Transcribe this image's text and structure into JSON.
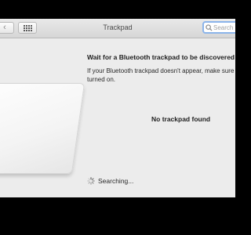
{
  "toolbar": {
    "back_glyph": "‹",
    "title": "Trackpad",
    "search_placeholder": "Search"
  },
  "main": {
    "heading": "Wait for a Bluetooth trackpad to be discovered",
    "info": "If your Bluetooth trackpad doesn't appear, make sure it's turned on.",
    "no_trackpad": "No trackpad found",
    "searching": "Searching..."
  },
  "icons": [
    "back-chevron-icon",
    "grid-icon",
    "magnifier-icon",
    "trackpad-image",
    "spinner-icon"
  ],
  "colors": {
    "search_focus": "#8bb4ea",
    "window_bg": "#ececec"
  }
}
